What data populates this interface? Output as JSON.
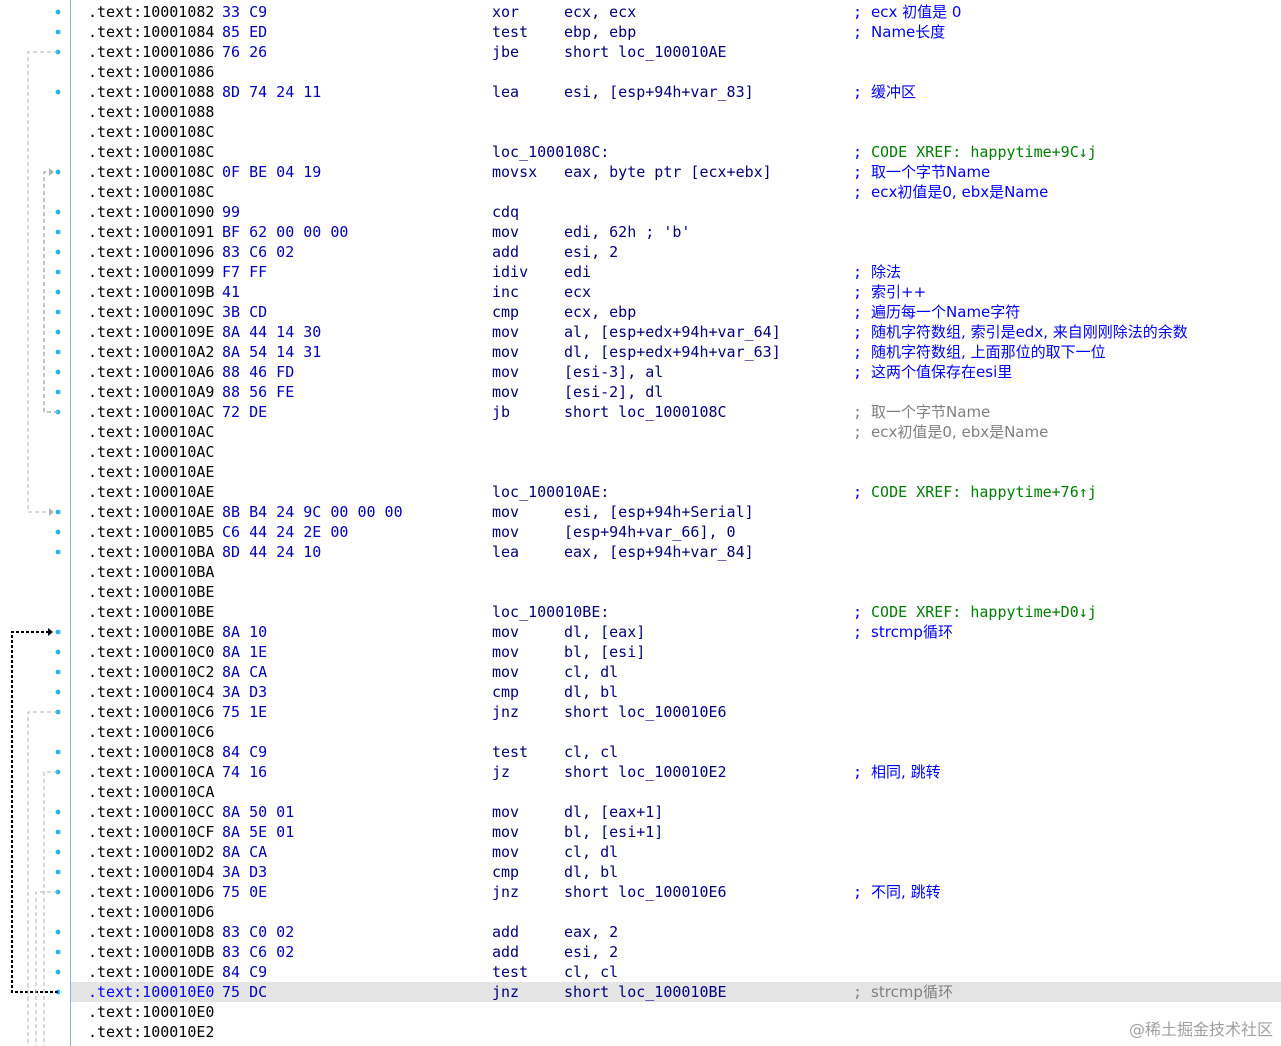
{
  "listing": [
    {
      "addr": ".text:10001082",
      "bytes": "33 C9",
      "mnem": "xor",
      "ops": "ecx, ecx",
      "cmt": "ecx 初值是 0"
    },
    {
      "addr": ".text:10001084",
      "bytes": "85 ED",
      "mnem": "test",
      "ops": "ebp, ebp",
      "cmt": "Name长度"
    },
    {
      "addr": ".text:10001086",
      "bytes": "76 26",
      "mnem": "jbe",
      "ops": "short loc_100010AE"
    },
    {
      "addr": ".text:10001086"
    },
    {
      "addr": ".text:10001088",
      "bytes": "8D 74 24 11",
      "mnem": "lea",
      "ops": "esi, [esp+94h+var_83]",
      "cmt": "缓冲区"
    },
    {
      "addr": ".text:10001088"
    },
    {
      "addr": ".text:1000108C"
    },
    {
      "addr": ".text:1000108C",
      "label": "loc_1000108C:",
      "cmt": "CODE XREF: happytime+9C↓j",
      "cmt_kind": "xref"
    },
    {
      "addr": ".text:1000108C",
      "bytes": "0F BE 04 19",
      "mnem": "movsx",
      "ops": "eax, byte ptr [ecx+ebx]",
      "cmt": "取一个字节Name"
    },
    {
      "addr": ".text:1000108C",
      "cmt": "ecx初值是0, ebx是Name"
    },
    {
      "addr": ".text:10001090",
      "bytes": "99",
      "mnem": "cdq"
    },
    {
      "addr": ".text:10001091",
      "bytes": "BF 62 00 00 00",
      "mnem": "mov",
      "ops": "edi, 62h ; 'b'"
    },
    {
      "addr": ".text:10001096",
      "bytes": "83 C6 02",
      "mnem": "add",
      "ops": "esi, 2"
    },
    {
      "addr": ".text:10001099",
      "bytes": "F7 FF",
      "mnem": "idiv",
      "ops": "edi",
      "cmt": "除法"
    },
    {
      "addr": ".text:1000109B",
      "bytes": "41",
      "mnem": "inc",
      "ops": "ecx",
      "cmt": "索引++"
    },
    {
      "addr": ".text:1000109C",
      "bytes": "3B CD",
      "mnem": "cmp",
      "ops": "ecx, ebp",
      "cmt": "遍历每一个Name字符"
    },
    {
      "addr": ".text:1000109E",
      "bytes": "8A 44 14 30",
      "mnem": "mov",
      "ops": "al, [esp+edx+94h+var_64]",
      "cmt": "随机字符数组, 索引是edx, 来自刚刚除法的余数"
    },
    {
      "addr": ".text:100010A2",
      "bytes": "8A 54 14 31",
      "mnem": "mov",
      "ops": "dl, [esp+edx+94h+var_63]",
      "cmt": "随机字符数组, 上面那位的取下一位"
    },
    {
      "addr": ".text:100010A6",
      "bytes": "88 46 FD",
      "mnem": "mov",
      "ops": "[esi-3], al",
      "cmt": "这两个值保存在esi里"
    },
    {
      "addr": ".text:100010A9",
      "bytes": "88 56 FE",
      "mnem": "mov",
      "ops": "[esi-2], dl"
    },
    {
      "addr": ".text:100010AC",
      "bytes": "72 DE",
      "mnem": "jb",
      "ops": "short loc_1000108C",
      "cmt": "取一个字节Name",
      "cmt_kind": "rep"
    },
    {
      "addr": ".text:100010AC",
      "cmt": "ecx初值是0, ebx是Name",
      "cmt_kind": "rep"
    },
    {
      "addr": ".text:100010AC"
    },
    {
      "addr": ".text:100010AE"
    },
    {
      "addr": ".text:100010AE",
      "label": "loc_100010AE:",
      "cmt": "CODE XREF: happytime+76↑j",
      "cmt_kind": "xref"
    },
    {
      "addr": ".text:100010AE",
      "bytes": "8B B4 24 9C 00 00 00",
      "mnem": "mov",
      "ops": "esi, [esp+94h+Serial]"
    },
    {
      "addr": ".text:100010B5",
      "bytes": "C6 44 24 2E 00",
      "mnem": "mov",
      "ops": "[esp+94h+var_66], 0"
    },
    {
      "addr": ".text:100010BA",
      "bytes": "8D 44 24 10",
      "mnem": "lea",
      "ops": "eax, [esp+94h+var_84]"
    },
    {
      "addr": ".text:100010BA"
    },
    {
      "addr": ".text:100010BE"
    },
    {
      "addr": ".text:100010BE",
      "label": "loc_100010BE:",
      "cmt": "CODE XREF: happytime+D0↓j",
      "cmt_kind": "xref"
    },
    {
      "addr": ".text:100010BE",
      "bytes": "8A 10",
      "mnem": "mov",
      "ops": "dl, [eax]",
      "cmt": "strcmp循环"
    },
    {
      "addr": ".text:100010C0",
      "bytes": "8A 1E",
      "mnem": "mov",
      "ops": "bl, [esi]"
    },
    {
      "addr": ".text:100010C2",
      "bytes": "8A CA",
      "mnem": "mov",
      "ops": "cl, dl"
    },
    {
      "addr": ".text:100010C4",
      "bytes": "3A D3",
      "mnem": "cmp",
      "ops": "dl, bl"
    },
    {
      "addr": ".text:100010C6",
      "bytes": "75 1E",
      "mnem": "jnz",
      "ops": "short loc_100010E6"
    },
    {
      "addr": ".text:100010C6"
    },
    {
      "addr": ".text:100010C8",
      "bytes": "84 C9",
      "mnem": "test",
      "ops": "cl, cl"
    },
    {
      "addr": ".text:100010CA",
      "bytes": "74 16",
      "mnem": "jz",
      "ops": "short loc_100010E2",
      "cmt": "相同, 跳转"
    },
    {
      "addr": ".text:100010CA"
    },
    {
      "addr": ".text:100010CC",
      "bytes": "8A 50 01",
      "mnem": "mov",
      "ops": "dl, [eax+1]"
    },
    {
      "addr": ".text:100010CF",
      "bytes": "8A 5E 01",
      "mnem": "mov",
      "ops": "bl, [esi+1]"
    },
    {
      "addr": ".text:100010D2",
      "bytes": "8A CA",
      "mnem": "mov",
      "ops": "cl, dl"
    },
    {
      "addr": ".text:100010D4",
      "bytes": "3A D3",
      "mnem": "cmp",
      "ops": "dl, bl"
    },
    {
      "addr": ".text:100010D6",
      "bytes": "75 0E",
      "mnem": "jnz",
      "ops": "short loc_100010E6",
      "cmt": "不同, 跳转"
    },
    {
      "addr": ".text:100010D6"
    },
    {
      "addr": ".text:100010D8",
      "bytes": "83 C0 02",
      "mnem": "add",
      "ops": "eax, 2"
    },
    {
      "addr": ".text:100010DB",
      "bytes": "83 C6 02",
      "mnem": "add",
      "ops": "esi, 2"
    },
    {
      "addr": ".text:100010DE",
      "bytes": "84 C9",
      "mnem": "test",
      "ops": "cl, cl"
    },
    {
      "addr": ".text:100010E0",
      "bytes": "75 DC",
      "mnem": "jnz",
      "ops": "short loc_100010BE",
      "cmt": "strcmp循环",
      "cmt_kind": "rep",
      "highlight": true
    },
    {
      "addr": ".text:100010E0"
    },
    {
      "addr": ".text:100010E2"
    }
  ],
  "watermark": "@稀土掘金技术社区",
  "colors": {
    "address": "#000000",
    "bytes": "#0000c0",
    "code": "#000080",
    "comment": "#0000ff",
    "xref": "#008000",
    "number": "#008000",
    "repeat": "#808080",
    "highlight_row": "#e4e4e4",
    "gutter_dot": "#20b8e8"
  }
}
